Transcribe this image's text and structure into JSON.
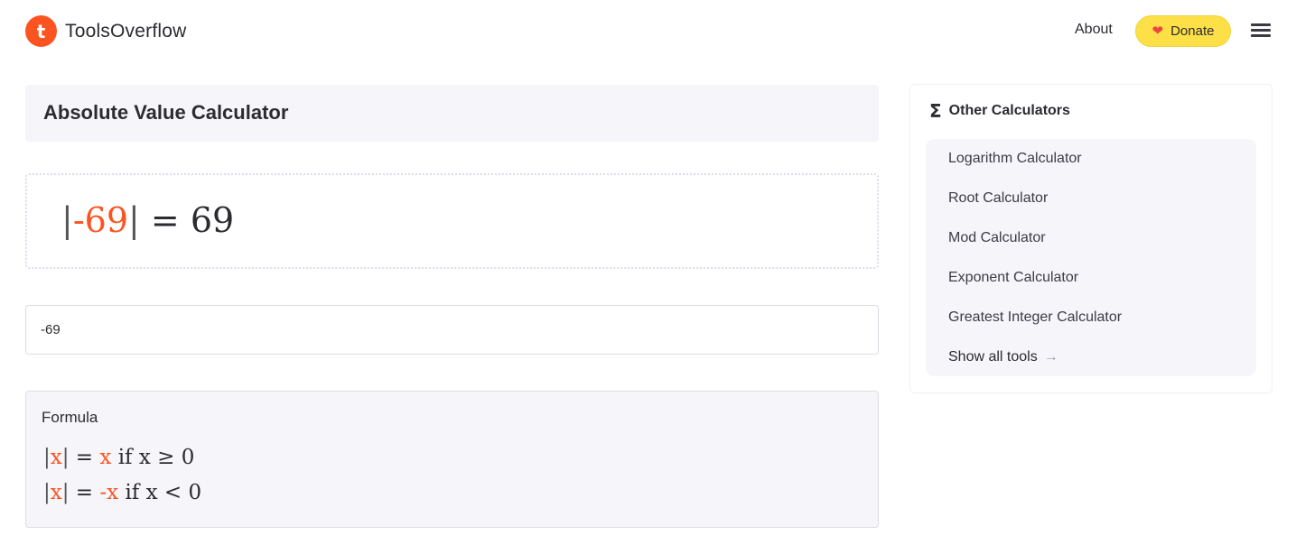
{
  "header": {
    "logo_letter": "t",
    "brand": "ToolsOverflow",
    "nav_about": "About",
    "donate_label": "Donate",
    "donate_icon": "heart-icon",
    "menu_icon": "hamburger-menu-icon"
  },
  "main": {
    "title": "Absolute Value Calculator",
    "result": {
      "bar_left": "|",
      "input_value": "-69",
      "bar_right": "|",
      "equals": "=",
      "output_value": "69"
    },
    "input": {
      "value": "-69"
    },
    "formula": {
      "label": "Formula",
      "lines": [
        {
          "bar_left": "|",
          "var": "x",
          "bar_right": "|",
          "eq": "=",
          "rhs": "x",
          "condition": "if x ≥ 0"
        },
        {
          "bar_left": "|",
          "var": "x",
          "bar_right": "|",
          "eq": "=",
          "rhs": "-x",
          "condition": "if x < 0"
        }
      ]
    }
  },
  "sidebar": {
    "icon": "sigma-icon",
    "title": "Other Calculators",
    "items": [
      {
        "label": "Logarithm Calculator"
      },
      {
        "label": "Root Calculator"
      },
      {
        "label": "Mod Calculator"
      },
      {
        "label": "Exponent Calculator"
      },
      {
        "label": "Greatest Integer Calculator"
      }
    ],
    "show_all_label": "Show all tools",
    "show_all_icon": "arrow-right-icon"
  },
  "colors": {
    "accent": "#fc5421",
    "donate_bg": "#fde047",
    "panel_bg": "#f5f5fa"
  }
}
